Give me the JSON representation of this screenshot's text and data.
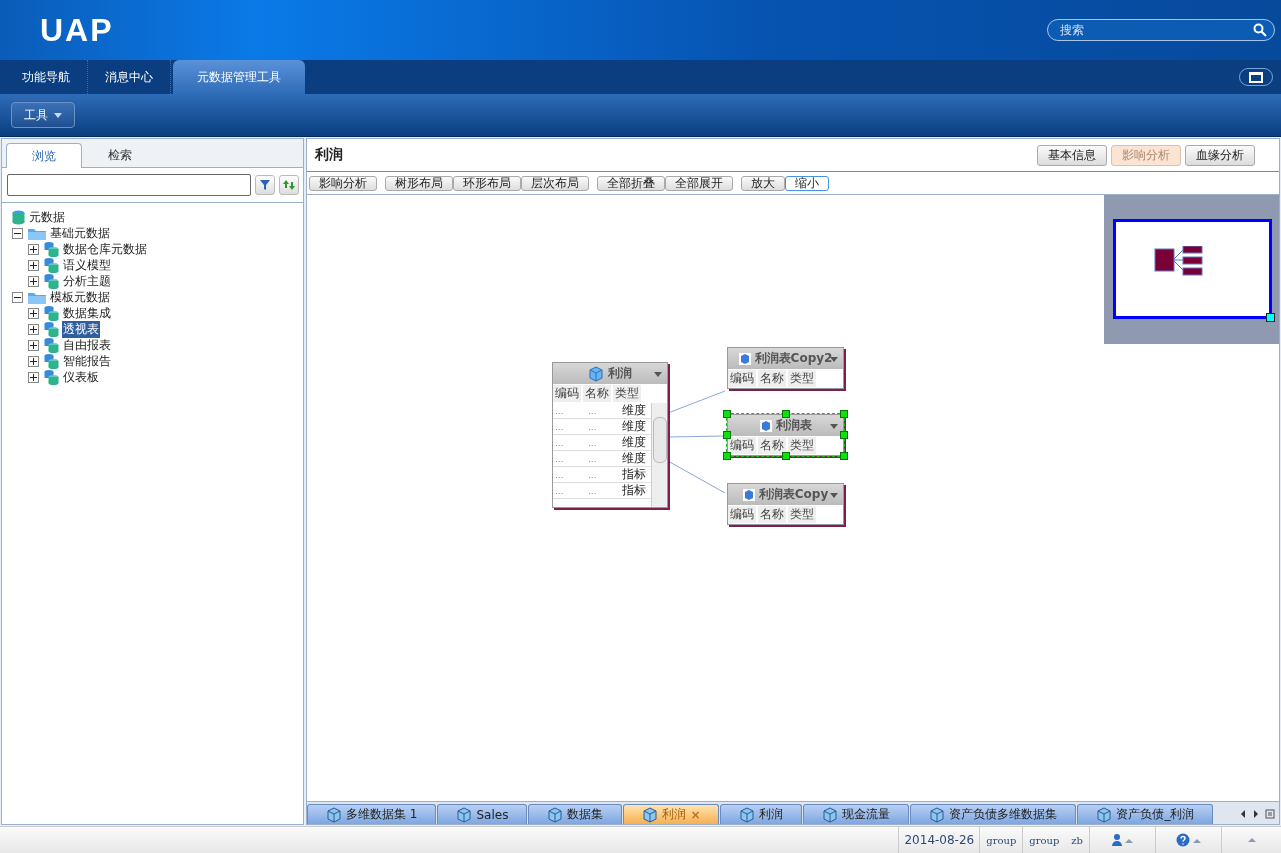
{
  "header": {
    "logo": "UAP",
    "search": {
      "placeholder": "搜索"
    }
  },
  "nav_tabs": [
    {
      "label": "功能导航",
      "selected": false
    },
    {
      "label": "消息中心",
      "selected": false
    },
    {
      "label": "元数据管理工具",
      "selected": true
    }
  ],
  "toolbar": {
    "menu": "工具"
  },
  "left_panel": {
    "tabs": [
      {
        "label": "浏览",
        "selected": true
      },
      {
        "label": "检索",
        "selected": false
      }
    ],
    "tree": [
      {
        "label": "元数据",
        "kind": "db",
        "selected": false,
        "children": [
          {
            "label": "基础元数据",
            "kind": "folder",
            "expanded": true,
            "selected": false,
            "children": [
              {
                "label": "数据仓库元数据",
                "kind": "multi",
                "expanded": false,
                "selected": false
              },
              {
                "label": "语义模型",
                "kind": "multi",
                "expanded": false,
                "selected": false
              },
              {
                "label": "分析主题",
                "kind": "multi",
                "expanded": false,
                "selected": false
              }
            ]
          },
          {
            "label": "模板元数据",
            "kind": "folder",
            "expanded": true,
            "selected": false,
            "children": [
              {
                "label": "数据集成",
                "kind": "multi",
                "expanded": false,
                "selected": false
              },
              {
                "label": "透视表",
                "kind": "multi",
                "expanded": false,
                "selected": true
              },
              {
                "label": "自由报表",
                "kind": "multi",
                "expanded": false,
                "selected": false
              },
              {
                "label": "智能报告",
                "kind": "multi",
                "expanded": false,
                "selected": false
              },
              {
                "label": "仪表板",
                "kind": "multi",
                "expanded": false,
                "selected": false
              }
            ]
          }
        ]
      }
    ]
  },
  "main": {
    "title": "利润",
    "view_buttons": [
      {
        "label": "基本信息",
        "selected": false
      },
      {
        "label": "影响分析",
        "selected": true
      },
      {
        "label": "血缘分析",
        "selected": false
      }
    ],
    "diagram_buttons": [
      {
        "label": "影响分析",
        "selected": false
      },
      {
        "label": "树形布局",
        "selected": false
      },
      {
        "label": "环形布局",
        "selected": false
      },
      {
        "label": "层次布局",
        "selected": false
      },
      {
        "label": "全部折叠",
        "selected": false
      },
      {
        "label": "全部展开",
        "selected": false
      },
      {
        "label": "放大",
        "selected": false
      },
      {
        "label": "缩小",
        "selected": true
      }
    ],
    "source_table": {
      "title": "利润",
      "columns": [
        "编码",
        "名称",
        "类型"
      ],
      "rows": [
        {
          "code": "...",
          "name": "...",
          "type": "维度"
        },
        {
          "code": "...",
          "name": "...",
          "type": "维度"
        },
        {
          "code": "...",
          "name": "...",
          "type": "维度"
        },
        {
          "code": "...",
          "name": "...",
          "type": "维度"
        },
        {
          "code": "...",
          "name": "...",
          "type": "指标"
        },
        {
          "code": "...",
          "name": "...",
          "type": "指标"
        }
      ]
    },
    "target_tables": [
      {
        "title": "利润表Copy2",
        "columns": [
          "编码",
          "名称",
          "类型"
        ],
        "selected": false
      },
      {
        "title": "利润表",
        "columns": [
          "编码",
          "名称",
          "类型"
        ],
        "selected": true
      },
      {
        "title": "利润表Copy",
        "columns": [
          "编码",
          "名称",
          "类型"
        ],
        "selected": false
      }
    ]
  },
  "bottom_tabs": [
    {
      "label": "多维数据集 1",
      "selected": false
    },
    {
      "label": "Sales",
      "selected": false
    },
    {
      "label": "数据集",
      "selected": false
    },
    {
      "label": "利润",
      "selected": true,
      "close": "×"
    },
    {
      "label": "利润",
      "selected": false
    },
    {
      "label": "现金流量",
      "selected": false
    },
    {
      "label": "资产负债多维数据集",
      "selected": false
    },
    {
      "label": "资产负债_利润",
      "selected": false
    }
  ],
  "status_bar": {
    "date": "2014-08-26",
    "items": [
      "group",
      "group",
      "zb"
    ]
  }
}
